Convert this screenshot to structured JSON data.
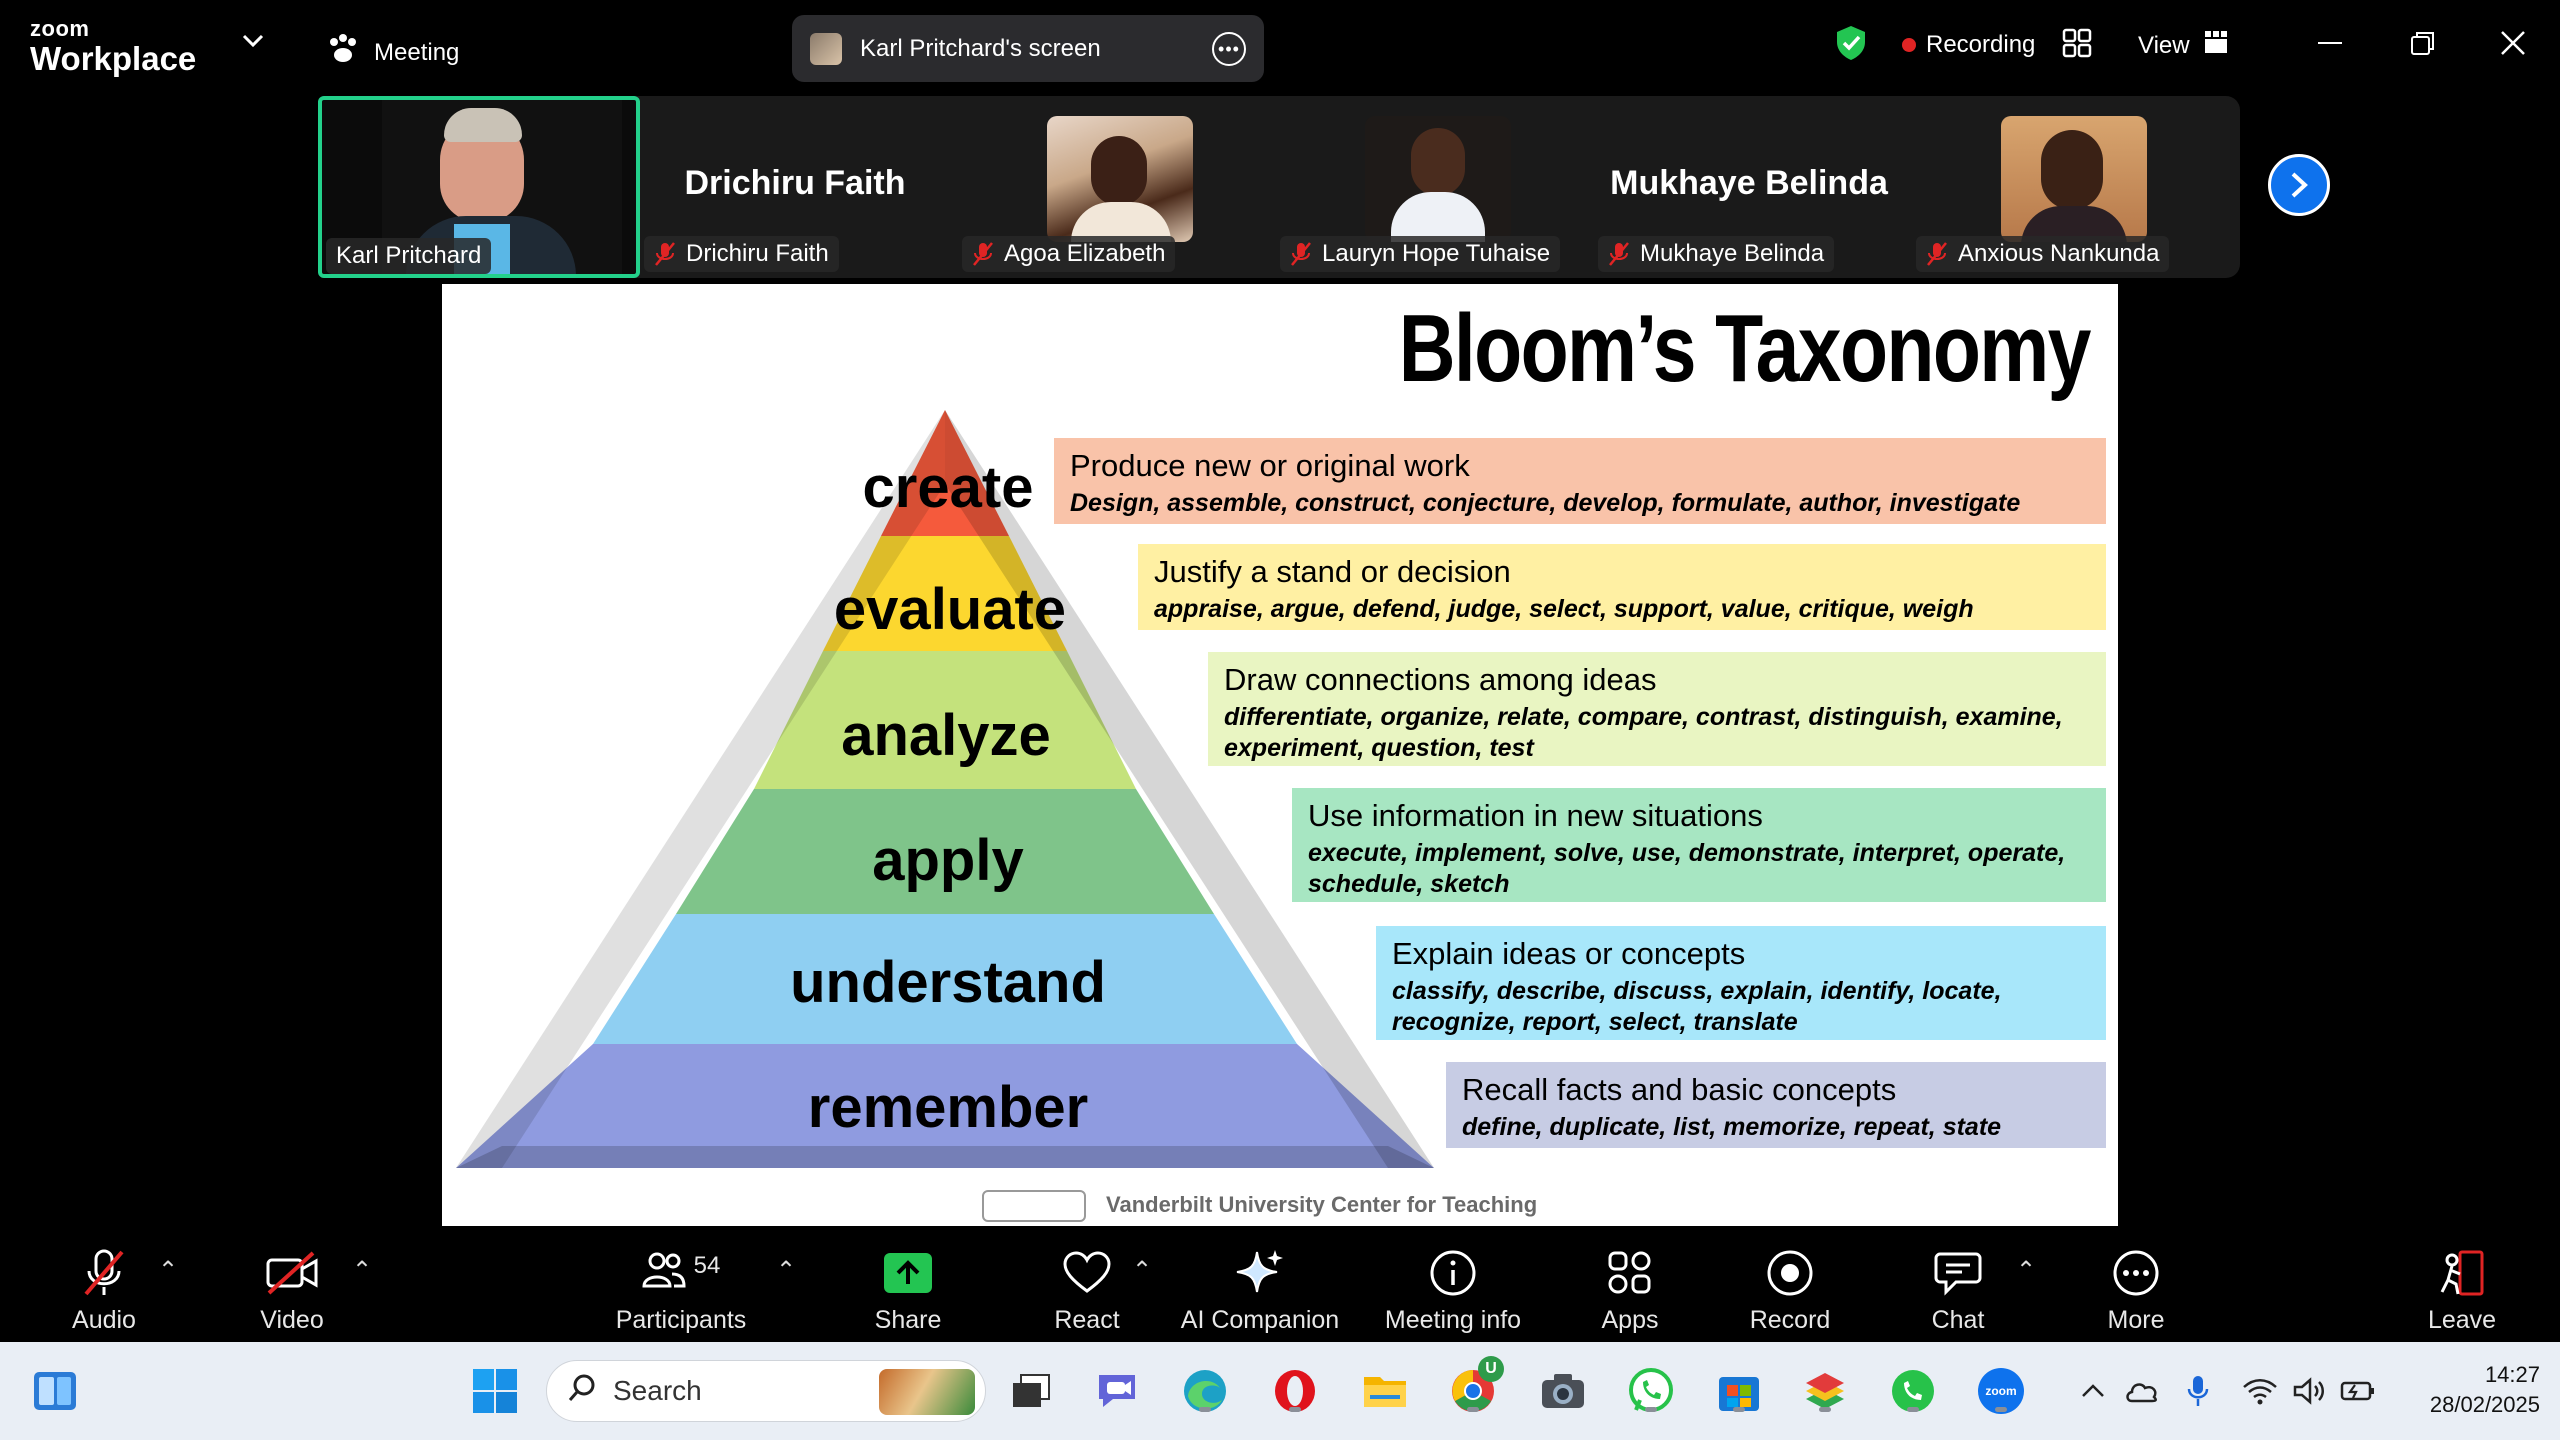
{
  "app": {
    "brand_small": "zoom",
    "brand_big": "Workplace"
  },
  "titlebar": {
    "meeting_label": "Meeting",
    "screen_label": "Karl Pritchard's screen",
    "recording_label": "Recording",
    "view_label": "View"
  },
  "gallery": {
    "tiles": [
      {
        "tag": "Karl Pritchard",
        "big_name": "",
        "mic_muted": false,
        "has_photo": true
      },
      {
        "tag": "Drichiru Faith",
        "big_name": "Drichiru Faith",
        "mic_muted": true,
        "has_photo": false
      },
      {
        "tag": "Agoa Elizabeth",
        "big_name": "",
        "mic_muted": true,
        "has_photo": true
      },
      {
        "tag": "Lauryn Hope Tuhaise",
        "big_name": "",
        "mic_muted": true,
        "has_photo": true
      },
      {
        "tag": "Mukhaye Belinda",
        "big_name": "Mukhaye Belinda",
        "mic_muted": true,
        "has_photo": false
      },
      {
        "tag": "Anxious Nankunda",
        "big_name": "",
        "mic_muted": true,
        "has_photo": true
      }
    ],
    "active_speaker_color": "#23d18b"
  },
  "slide": {
    "title": "Bloom’s Taxonomy",
    "levels": [
      {
        "word": "create",
        "heading": "Produce new or original work",
        "detail": "Design, assemble, construct, conjecture, develop, formulate, author, investigate",
        "color": "#f9c3a9",
        "tier": "#f55a3c"
      },
      {
        "word": "evaluate",
        "heading": "Justify a stand or decision",
        "detail": "appraise, argue, defend, judge, select, support, value, critique, weigh",
        "color": "#fff0a3",
        "tier": "#fcd72f"
      },
      {
        "word": "analyze",
        "heading": "Draw connections among ideas",
        "detail": "differentiate, organize, relate, compare, contrast, distinguish, examine, experiment, question, test",
        "color": "#e9f5c2",
        "tier": "#c4e27c"
      },
      {
        "word": "apply",
        "heading": "Use information in new situations",
        "detail": "execute, implement, solve, use, demonstrate, interpret, operate, schedule, sketch",
        "color": "#a7e6c2",
        "tier": "#7fc48a"
      },
      {
        "word": "understand",
        "heading": "Explain ideas or concepts",
        "detail": "classify, describe, discuss, explain, identify, locate, recognize, report, select, translate",
        "color": "#a8e7fa",
        "tier": "#8fcff2"
      },
      {
        "word": "remember",
        "heading": "Recall facts and basic concepts",
        "detail": "define, duplicate, list, memorize, repeat, state",
        "color": "#c7cce4",
        "tier": "#8f9be0"
      }
    ],
    "credit": "Vanderbilt University Center for Teaching"
  },
  "toolbar": {
    "audio": "Audio",
    "video": "Video",
    "participants": "Participants",
    "participants_count": "54",
    "share": "Share",
    "react": "React",
    "ai_companion": "AI Companion",
    "meeting_info": "Meeting info",
    "apps": "Apps",
    "record": "Record",
    "chat": "Chat",
    "more": "More",
    "leave": "Leave"
  },
  "taskbar": {
    "search_placeholder": "Search",
    "time": "14:27",
    "date": "28/02/2025",
    "zoom_icon_text": "zoom",
    "badge_letter": "U"
  }
}
